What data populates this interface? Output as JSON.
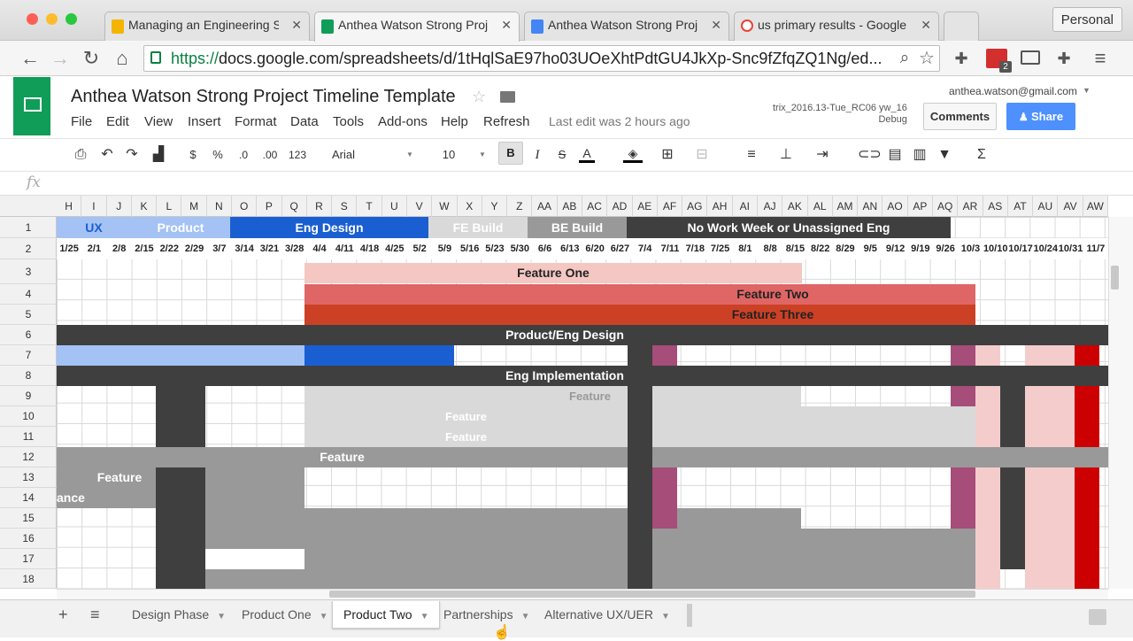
{
  "browser": {
    "tabs": [
      {
        "title": "Managing an Engineering S",
        "icon": "slides-icon",
        "color": "#f4b400"
      },
      {
        "title": "Anthea Watson Strong Proj",
        "icon": "sheets-icon",
        "color": "#0f9d58"
      },
      {
        "title": "Anthea Watson Strong Proj",
        "icon": "docs-icon",
        "color": "#4285f4"
      },
      {
        "title": "us primary results - Google",
        "icon": "google-icon",
        "color": "#ea4335"
      }
    ],
    "close": "✕",
    "profile": "Personal",
    "url_scheme": "https://",
    "url_rest": "docs.google.com/spreadsheets/d/1tHqlSaE97ho03UOeXhtPdtGU4JkXp-Snc9fZfqZQ1Ng/ed...",
    "extension_badge": "2"
  },
  "doc": {
    "title": "Anthea Watson Strong Project Timeline Template",
    "menu": [
      "File",
      "Edit",
      "View",
      "Insert",
      "Format",
      "Data",
      "Tools",
      "Add-ons",
      "Help",
      "Refresh"
    ],
    "last_edit": "Last edit was 2 hours ago",
    "account": "anthea.watson@gmail.com",
    "build_line1": "trix_2016.13-Tue_RC06 yw_16",
    "build_line2": "Debug",
    "comments": "Comments",
    "share": "Share"
  },
  "toolbar": {
    "currency": "$",
    "percent": "%",
    "dec_less": ".0",
    "dec_more": ".00",
    "format": "123",
    "font": "Arial",
    "size": "10",
    "bold": "B",
    "italic": "I",
    "strike": "S",
    "text_color": "A",
    "sigma": "Σ",
    "fx": "fx"
  },
  "columns": [
    "H",
    "I",
    "J",
    "K",
    "L",
    "M",
    "N",
    "O",
    "P",
    "Q",
    "R",
    "S",
    "T",
    "U",
    "V",
    "W",
    "X",
    "Y",
    "Z",
    "AA",
    "AB",
    "AC",
    "AD",
    "AE",
    "AF",
    "AG",
    "AH",
    "AI",
    "AJ",
    "AK",
    "AL",
    "AM",
    "AN",
    "AO",
    "AP",
    "AQ",
    "AR",
    "AS",
    "AT",
    "AU",
    "AV",
    "AW"
  ],
  "rows": [
    "1",
    "2",
    "3",
    "4",
    "5",
    "6",
    "7",
    "8",
    "9",
    "10",
    "11",
    "12",
    "13",
    "14",
    "15",
    "16",
    "17",
    "18"
  ],
  "dates": [
    "1/25",
    "2/1",
    "2/8",
    "2/15",
    "2/22",
    "2/29",
    "3/7",
    "3/14",
    "3/21",
    "3/28",
    "4/4",
    "4/11",
    "4/18",
    "4/25",
    "5/2",
    "5/9",
    "5/16",
    "5/23",
    "5/30",
    "6/6",
    "6/13",
    "6/20",
    "6/27",
    "7/4",
    "7/11",
    "7/18",
    "7/25",
    "8/1",
    "8/8",
    "8/15",
    "8/22",
    "8/29",
    "9/5",
    "9/12",
    "9/19",
    "9/26",
    "10/3",
    "10/10",
    "10/17",
    "10/24",
    "10/31",
    "11/7"
  ],
  "phases": {
    "ux": "UX",
    "product": "Product",
    "eng_design": "Eng Design",
    "fe_build": "FE Build",
    "be_build": "BE Build",
    "no_work": "No Work Week or Unassigned Eng"
  },
  "bars": {
    "feature_one": "Feature One",
    "feature_two": "Feature Two",
    "feature_three": "Feature Three",
    "product_eng_design": "Product/Eng Design",
    "eng_implementation": "Eng Implementation",
    "feature": "Feature",
    "ance": "ance"
  },
  "sheets": [
    "Design Phase",
    "Product One",
    "Product Two",
    "Partnerships",
    "Alternative UX/UER"
  ],
  "active_sheet": "Product Two",
  "colors": {
    "sheets_green": "#0f9d58",
    "share_blue": "#4d90fe",
    "dark_gray": "#3f3f3f",
    "eng_blue": "#1a5fd1",
    "red": "#cc0000"
  }
}
